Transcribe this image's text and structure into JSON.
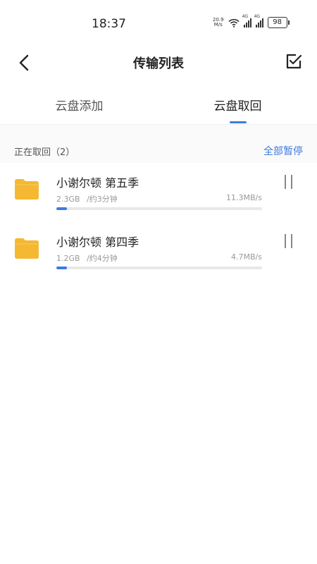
{
  "status_bar": {
    "time": "18:37",
    "net_speed_value": "20.9",
    "net_speed_unit": "M/s",
    "signal1_tag": "4G",
    "signal2_tag": "4G",
    "battery": "98"
  },
  "header": {
    "title": "传输列表",
    "back_icon": "chevron-left-icon",
    "select_icon": "check-square-icon"
  },
  "tabs": [
    {
      "label": "云盘添加",
      "active": false
    },
    {
      "label": "云盘取回",
      "active": true
    }
  ],
  "section": {
    "label": "正在取回（2）",
    "action": "全部暂停"
  },
  "items": [
    {
      "name": "小谢尔顿 第五季",
      "size": "2.3GB",
      "eta": "/约3分钟",
      "speed": "11.3MB/s",
      "progress": 0.05
    },
    {
      "name": "小谢尔顿 第四季",
      "size": "1.2GB",
      "eta": "/约4分钟",
      "speed": "4.7MB/s",
      "progress": 0.05
    }
  ],
  "colors": {
    "accent": "#3d7be0",
    "folder": "#f5b833",
    "muted_text": "#999999"
  }
}
